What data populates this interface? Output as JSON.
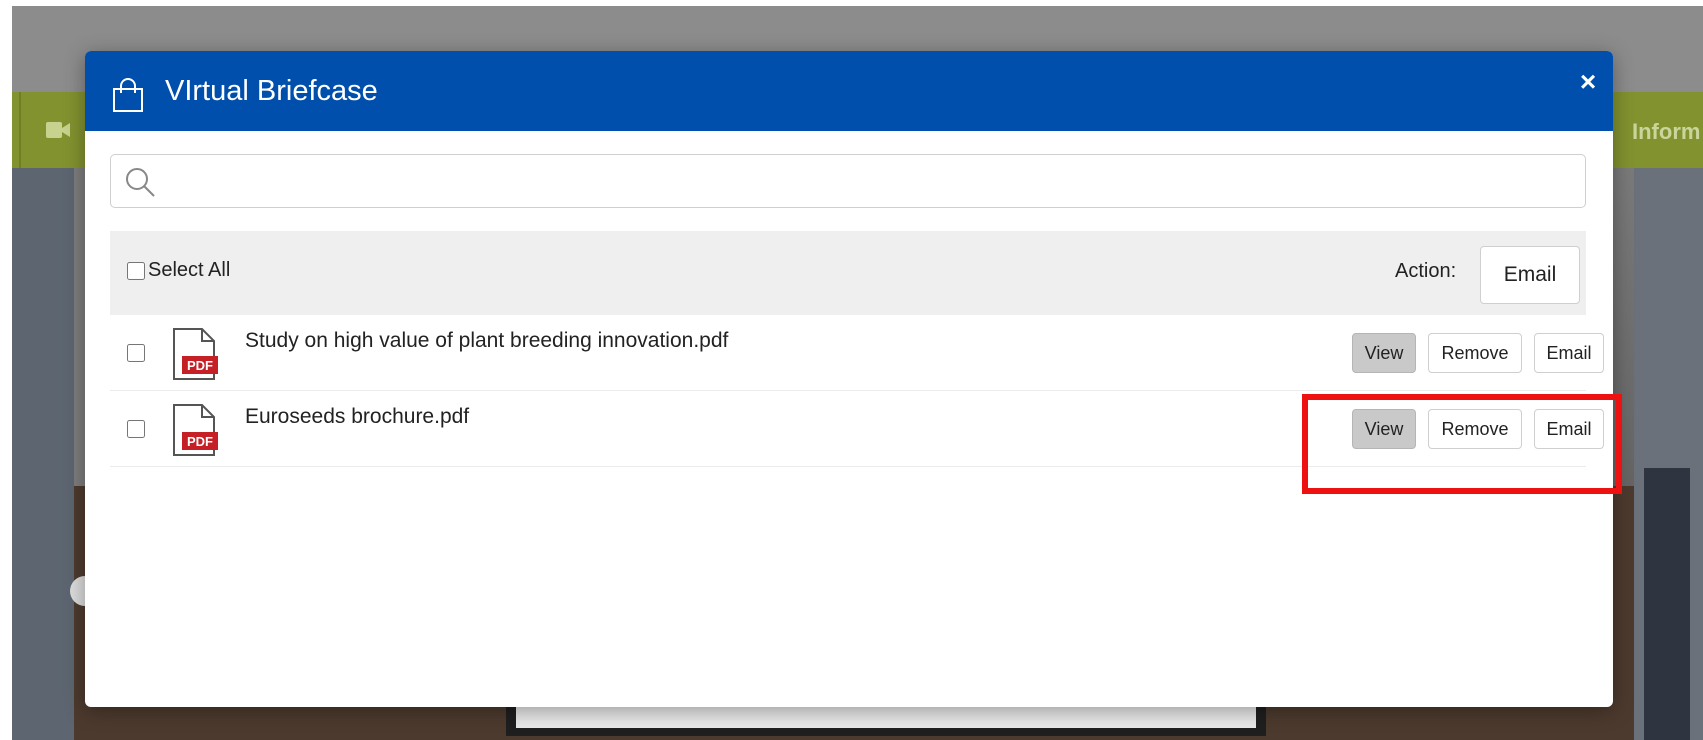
{
  "modal": {
    "title": "VIrtual Briefcase",
    "close_label": "×",
    "header_color": "#004fad",
    "icon": "shopping-bag-icon"
  },
  "background": {
    "nav_label": "Inform",
    "camera_icon": "video-camera-icon",
    "bar_color": "#82922f"
  },
  "search": {
    "placeholder": "",
    "value": "",
    "icon": "search-icon"
  },
  "action_bar": {
    "select_all_label": "Select All",
    "action_label": "Action:",
    "email_label": "Email"
  },
  "files": [
    {
      "name": "Study on high value of plant breeding innovation.pdf",
      "type_label": "PDF",
      "view_label": "View",
      "remove_label": "Remove",
      "email_label": "Email"
    },
    {
      "name": "Euroseeds brochure.pdf",
      "type_label": "PDF",
      "view_label": "View",
      "remove_label": "Remove",
      "email_label": "Email"
    }
  ],
  "highlight": {
    "color": "#ee1111"
  }
}
